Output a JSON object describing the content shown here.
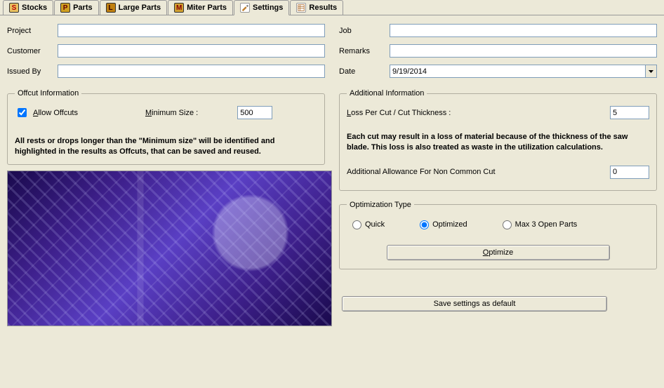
{
  "tabs": [
    {
      "label": "Stocks"
    },
    {
      "label": "Parts"
    },
    {
      "label": "Large Parts"
    },
    {
      "label": "Miter Parts"
    },
    {
      "label": "Settings"
    },
    {
      "label": "Results"
    }
  ],
  "left_fields": {
    "project_label": "Project",
    "project_value": "",
    "customer_label": "Customer",
    "customer_value": "",
    "issuedby_label": "Issued By",
    "issuedby_value": ""
  },
  "right_fields": {
    "job_label": "Job",
    "job_value": "",
    "remarks_label": "Remarks",
    "remarks_value": "",
    "date_label": "Date",
    "date_value": "9/19/2014"
  },
  "offcut": {
    "legend": "Offcut Information",
    "allow_label_pre": "A",
    "allow_label_rest": "llow Offcuts",
    "allow_checked": true,
    "minsize_label_pre": "M",
    "minsize_label_rest": "inimum Size :",
    "minsize_value": "500",
    "info": "All rests or drops longer than the \"Minimum size\" will be identified and highlighted in the results as Offcuts, that can be saved and reused."
  },
  "additional": {
    "legend": "Additional Information",
    "loss_label_pre": "L",
    "loss_label_rest": "oss Per Cut / Cut Thickness :",
    "loss_value": "5",
    "info": "Each cut may result in a loss of material because of the thickness of the saw blade. This loss is also treated as waste in the utilization calculations.",
    "allowance_label": "Additional Allowance For Non Common Cut",
    "allowance_value": "0"
  },
  "optimization": {
    "legend": "Optimization Type",
    "quick": "Quick",
    "optimized": "Optimized",
    "max3": "Max 3 Open Parts",
    "selected": "optimized",
    "optimize_btn_pre": "O",
    "optimize_btn_rest": "ptimize"
  },
  "save_btn": "Save settings as default"
}
